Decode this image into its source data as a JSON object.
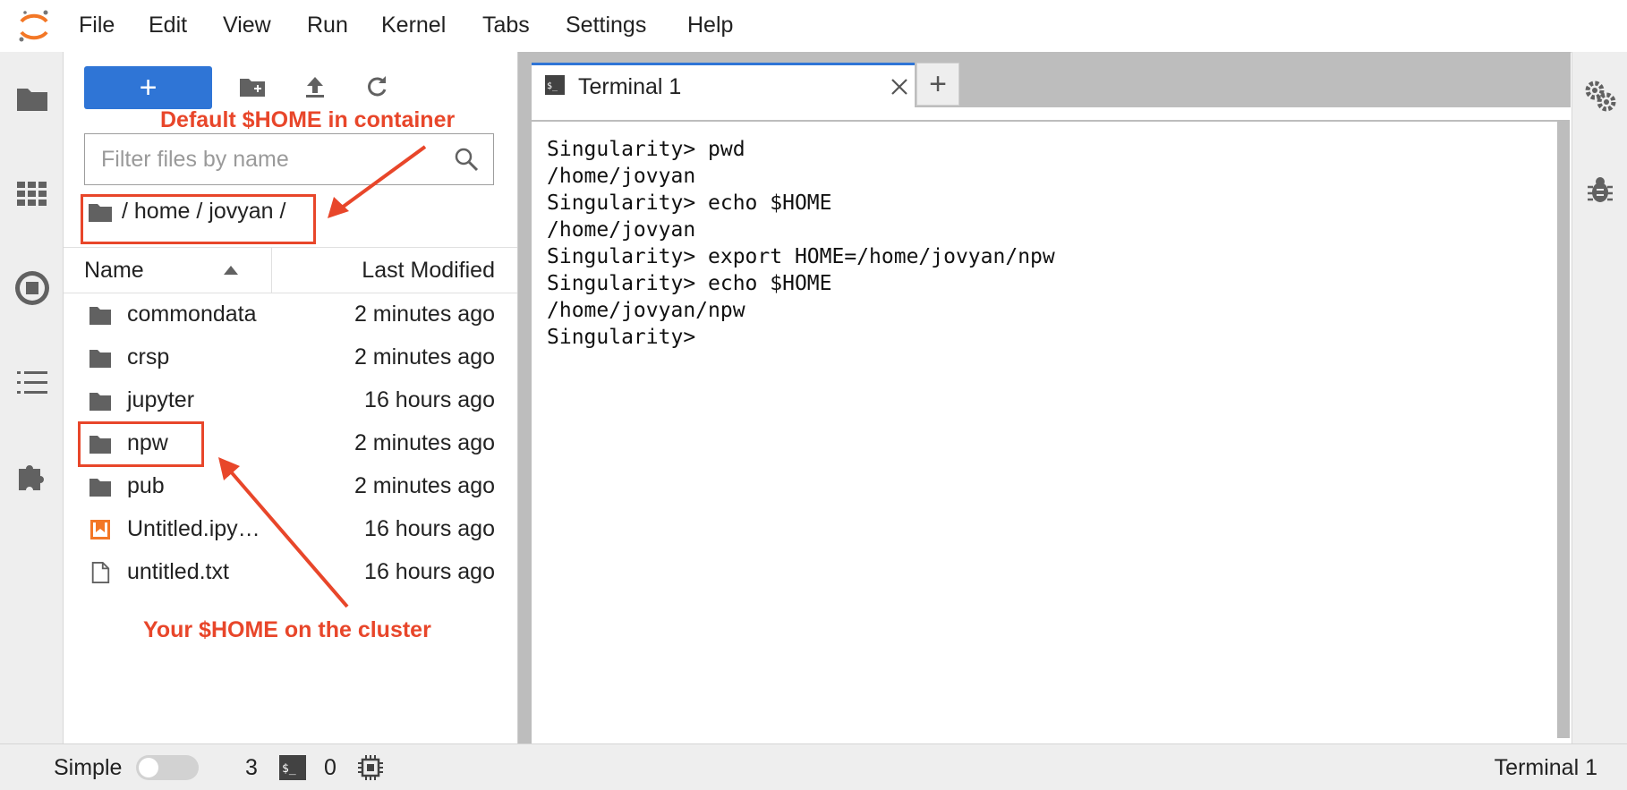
{
  "menubar": {
    "logo_icon": "jupyter-logo-icon",
    "items": [
      "File",
      "Edit",
      "View",
      "Run",
      "Kernel",
      "Tabs",
      "Settings",
      "Help"
    ]
  },
  "activity_bar": {
    "icons": [
      "folder-icon",
      "grid-icon",
      "stop-circle-icon",
      "list-icon",
      "puzzle-icon"
    ]
  },
  "file_browser": {
    "new_button_label": "+",
    "toolbar_icons": [
      "new-folder-icon",
      "upload-icon",
      "refresh-icon"
    ],
    "filter_placeholder": "Filter files by name",
    "breadcrumb": "/ home / jovyan /",
    "columns": {
      "name": "Name",
      "modified": "Last Modified"
    },
    "files": [
      {
        "name": "commondata",
        "modified": "2 minutes ago",
        "type": "folder"
      },
      {
        "name": "crsp",
        "modified": "2 minutes ago",
        "type": "folder"
      },
      {
        "name": "jupyter",
        "modified": "16 hours ago",
        "type": "folder"
      },
      {
        "name": "npw",
        "modified": "2 minutes ago",
        "type": "folder"
      },
      {
        "name": "pub",
        "modified": "2 minutes ago",
        "type": "folder"
      },
      {
        "name": "Untitled.ipy…",
        "modified": "16 hours ago",
        "type": "notebook"
      },
      {
        "name": "untitled.txt",
        "modified": "16 hours ago",
        "type": "file"
      }
    ]
  },
  "tabs": {
    "terminal_label": "Terminal 1",
    "add_label": "+"
  },
  "terminal": {
    "lines": [
      "Singularity> pwd",
      "/home/jovyan",
      "Singularity> echo $HOME",
      "/home/jovyan",
      "Singularity> export HOME=/home/jovyan/npw",
      "Singularity> echo $HOME",
      "/home/jovyan/npw",
      "Singularity>"
    ]
  },
  "right_bar": {
    "icons": [
      "property-inspector-icon",
      "debugger-icon"
    ]
  },
  "statusbar": {
    "mode_label": "Simple",
    "kernel_count": "3",
    "terminal_count": "0",
    "right_label": "Terminal 1"
  },
  "annotations": {
    "top": "Default $HOME in container",
    "bottom": "Your $HOME on the cluster"
  },
  "colors": {
    "accent": "#2f75d6",
    "annotation": "#e8462a",
    "jupyter_orange": "#f37726"
  }
}
